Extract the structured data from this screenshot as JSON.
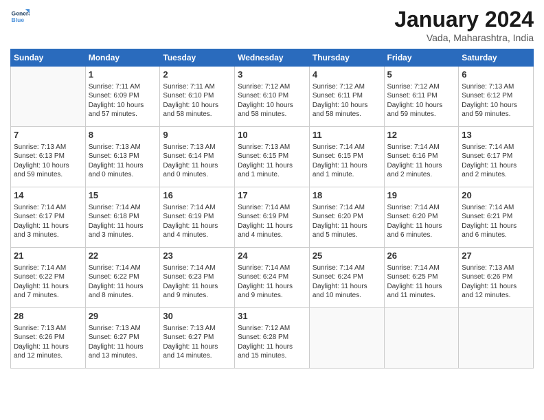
{
  "header": {
    "logo_line1": "General",
    "logo_line2": "Blue",
    "month_year": "January 2024",
    "location": "Vada, Maharashtra, India"
  },
  "weekdays": [
    "Sunday",
    "Monday",
    "Tuesday",
    "Wednesday",
    "Thursday",
    "Friday",
    "Saturday"
  ],
  "weeks": [
    [
      {
        "day": "",
        "info": ""
      },
      {
        "day": "1",
        "info": "Sunrise: 7:11 AM\nSunset: 6:09 PM\nDaylight: 10 hours\nand 57 minutes."
      },
      {
        "day": "2",
        "info": "Sunrise: 7:11 AM\nSunset: 6:10 PM\nDaylight: 10 hours\nand 58 minutes."
      },
      {
        "day": "3",
        "info": "Sunrise: 7:12 AM\nSunset: 6:10 PM\nDaylight: 10 hours\nand 58 minutes."
      },
      {
        "day": "4",
        "info": "Sunrise: 7:12 AM\nSunset: 6:11 PM\nDaylight: 10 hours\nand 58 minutes."
      },
      {
        "day": "5",
        "info": "Sunrise: 7:12 AM\nSunset: 6:11 PM\nDaylight: 10 hours\nand 59 minutes."
      },
      {
        "day": "6",
        "info": "Sunrise: 7:13 AM\nSunset: 6:12 PM\nDaylight: 10 hours\nand 59 minutes."
      }
    ],
    [
      {
        "day": "7",
        "info": "Sunrise: 7:13 AM\nSunset: 6:13 PM\nDaylight: 10 hours\nand 59 minutes."
      },
      {
        "day": "8",
        "info": "Sunrise: 7:13 AM\nSunset: 6:13 PM\nDaylight: 11 hours\nand 0 minutes."
      },
      {
        "day": "9",
        "info": "Sunrise: 7:13 AM\nSunset: 6:14 PM\nDaylight: 11 hours\nand 0 minutes."
      },
      {
        "day": "10",
        "info": "Sunrise: 7:13 AM\nSunset: 6:15 PM\nDaylight: 11 hours\nand 1 minute."
      },
      {
        "day": "11",
        "info": "Sunrise: 7:14 AM\nSunset: 6:15 PM\nDaylight: 11 hours\nand 1 minute."
      },
      {
        "day": "12",
        "info": "Sunrise: 7:14 AM\nSunset: 6:16 PM\nDaylight: 11 hours\nand 2 minutes."
      },
      {
        "day": "13",
        "info": "Sunrise: 7:14 AM\nSunset: 6:17 PM\nDaylight: 11 hours\nand 2 minutes."
      }
    ],
    [
      {
        "day": "14",
        "info": "Sunrise: 7:14 AM\nSunset: 6:17 PM\nDaylight: 11 hours\nand 3 minutes."
      },
      {
        "day": "15",
        "info": "Sunrise: 7:14 AM\nSunset: 6:18 PM\nDaylight: 11 hours\nand 3 minutes."
      },
      {
        "day": "16",
        "info": "Sunrise: 7:14 AM\nSunset: 6:19 PM\nDaylight: 11 hours\nand 4 minutes."
      },
      {
        "day": "17",
        "info": "Sunrise: 7:14 AM\nSunset: 6:19 PM\nDaylight: 11 hours\nand 4 minutes."
      },
      {
        "day": "18",
        "info": "Sunrise: 7:14 AM\nSunset: 6:20 PM\nDaylight: 11 hours\nand 5 minutes."
      },
      {
        "day": "19",
        "info": "Sunrise: 7:14 AM\nSunset: 6:20 PM\nDaylight: 11 hours\nand 6 minutes."
      },
      {
        "day": "20",
        "info": "Sunrise: 7:14 AM\nSunset: 6:21 PM\nDaylight: 11 hours\nand 6 minutes."
      }
    ],
    [
      {
        "day": "21",
        "info": "Sunrise: 7:14 AM\nSunset: 6:22 PM\nDaylight: 11 hours\nand 7 minutes."
      },
      {
        "day": "22",
        "info": "Sunrise: 7:14 AM\nSunset: 6:22 PM\nDaylight: 11 hours\nand 8 minutes."
      },
      {
        "day": "23",
        "info": "Sunrise: 7:14 AM\nSunset: 6:23 PM\nDaylight: 11 hours\nand 9 minutes."
      },
      {
        "day": "24",
        "info": "Sunrise: 7:14 AM\nSunset: 6:24 PM\nDaylight: 11 hours\nand 9 minutes."
      },
      {
        "day": "25",
        "info": "Sunrise: 7:14 AM\nSunset: 6:24 PM\nDaylight: 11 hours\nand 10 minutes."
      },
      {
        "day": "26",
        "info": "Sunrise: 7:14 AM\nSunset: 6:25 PM\nDaylight: 11 hours\nand 11 minutes."
      },
      {
        "day": "27",
        "info": "Sunrise: 7:13 AM\nSunset: 6:26 PM\nDaylight: 11 hours\nand 12 minutes."
      }
    ],
    [
      {
        "day": "28",
        "info": "Sunrise: 7:13 AM\nSunset: 6:26 PM\nDaylight: 11 hours\nand 12 minutes."
      },
      {
        "day": "29",
        "info": "Sunrise: 7:13 AM\nSunset: 6:27 PM\nDaylight: 11 hours\nand 13 minutes."
      },
      {
        "day": "30",
        "info": "Sunrise: 7:13 AM\nSunset: 6:27 PM\nDaylight: 11 hours\nand 14 minutes."
      },
      {
        "day": "31",
        "info": "Sunrise: 7:12 AM\nSunset: 6:28 PM\nDaylight: 11 hours\nand 15 minutes."
      },
      {
        "day": "",
        "info": ""
      },
      {
        "day": "",
        "info": ""
      },
      {
        "day": "",
        "info": ""
      }
    ]
  ]
}
